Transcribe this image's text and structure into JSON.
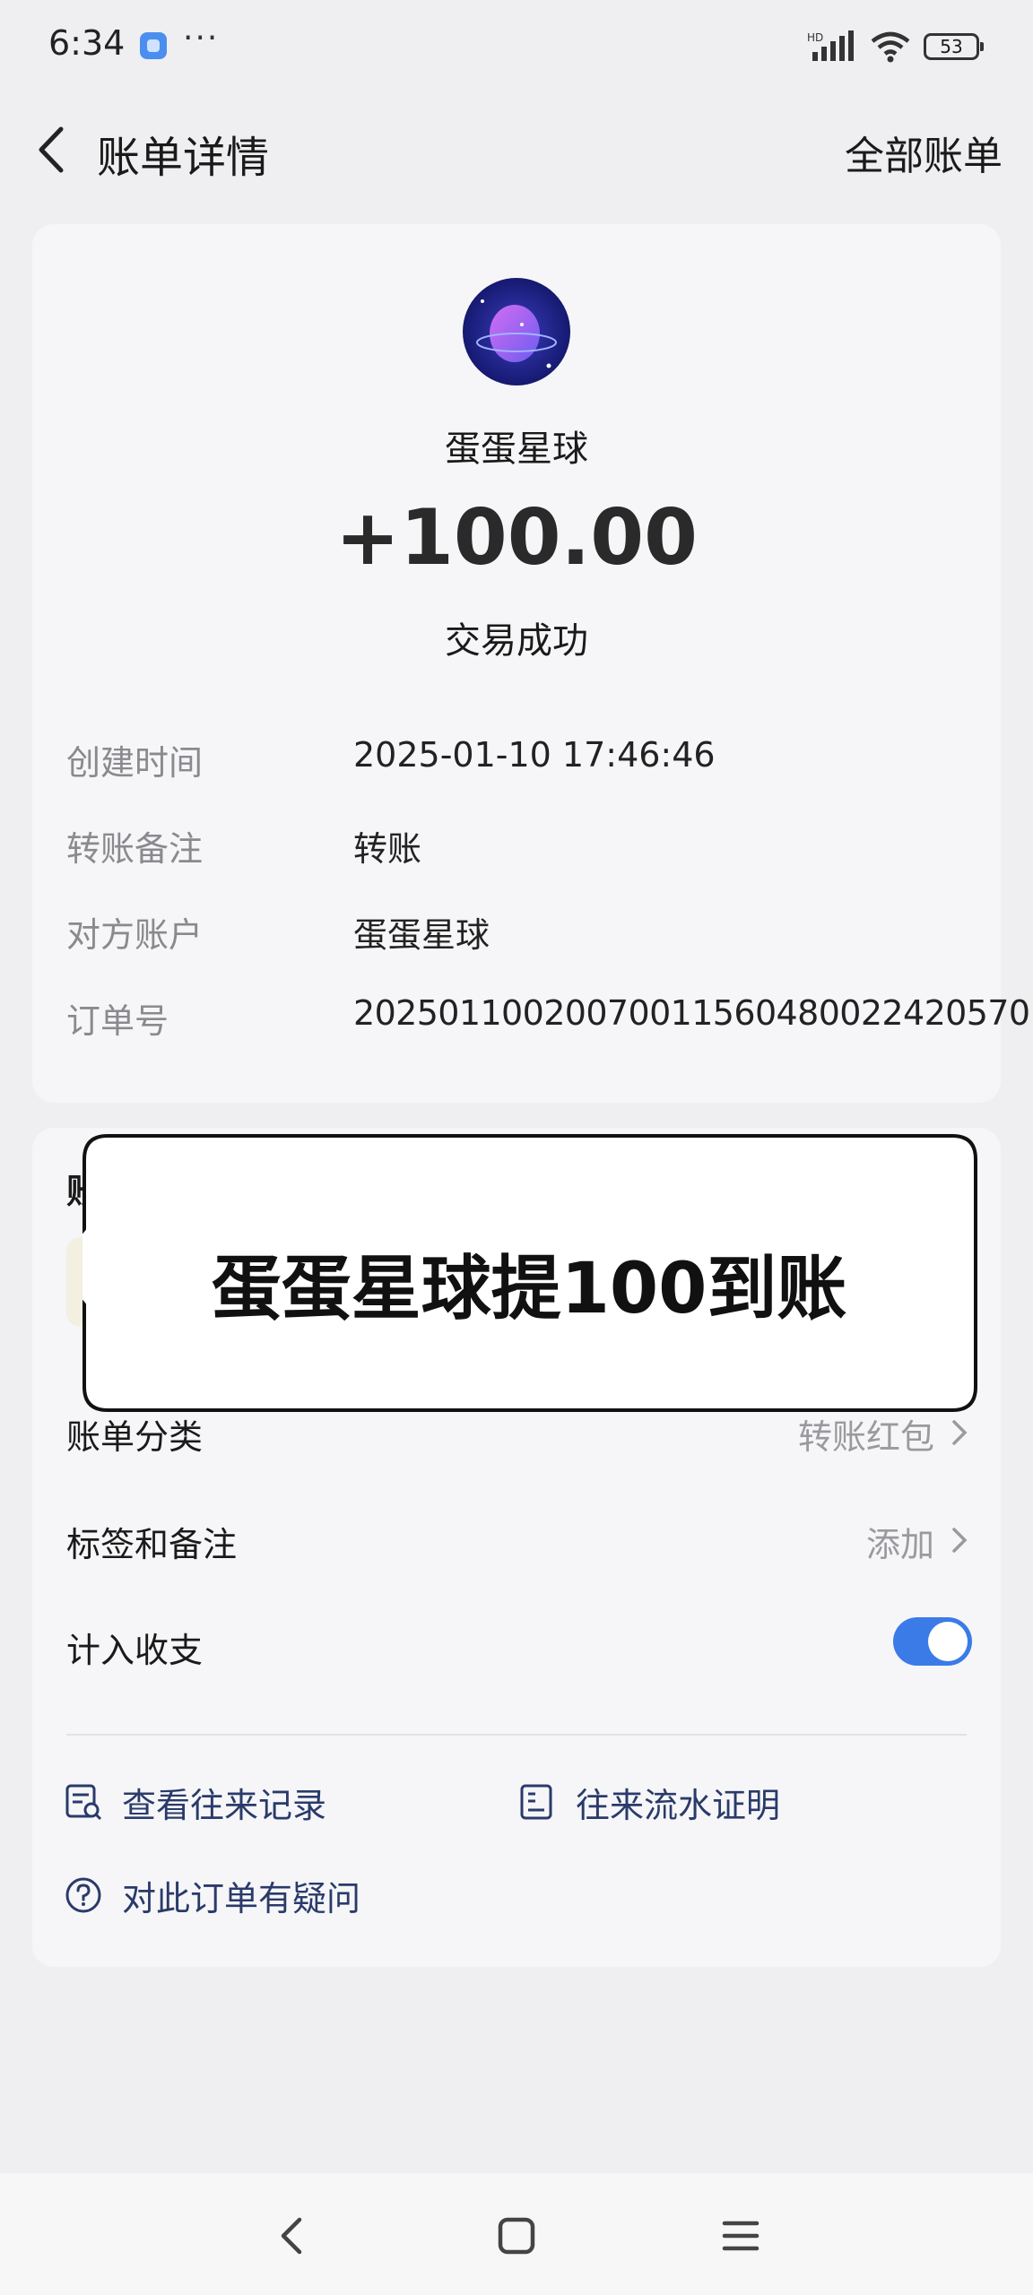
{
  "status_bar": {
    "time": "6:34",
    "dots": "···",
    "battery": "53",
    "hd": "HD"
  },
  "nav": {
    "title": "账单详情",
    "right_link": "全部账单"
  },
  "summary": {
    "merchant": "蛋蛋星球",
    "amount": "+100.00",
    "status": "交易成功"
  },
  "details": [
    {
      "label": "创建时间",
      "value": "2025-01-10 17:46:46"
    },
    {
      "label": "转账备注",
      "value": "转账"
    },
    {
      "label": "对方账户",
      "value": "蛋蛋星球"
    },
    {
      "label": "订单号",
      "value": "20250110020070011560480022420570"
    }
  ],
  "partial": {
    "label": "账单",
    "chip": "为"
  },
  "callout": {
    "text": "蛋蛋星球提100到账"
  },
  "settings": {
    "category_label": "账单分类",
    "category_value": "转账红包",
    "tags_label": "标签和备注",
    "tags_value": "添加",
    "include_label": "计入收支",
    "include_on": true
  },
  "actions": {
    "history": "查看往来记录",
    "statement": "往来流水证明",
    "question": "对此订单有疑问"
  },
  "colors": {
    "accent": "#3b7be8",
    "background": "#efeff1",
    "card": "#f6f6f8"
  }
}
